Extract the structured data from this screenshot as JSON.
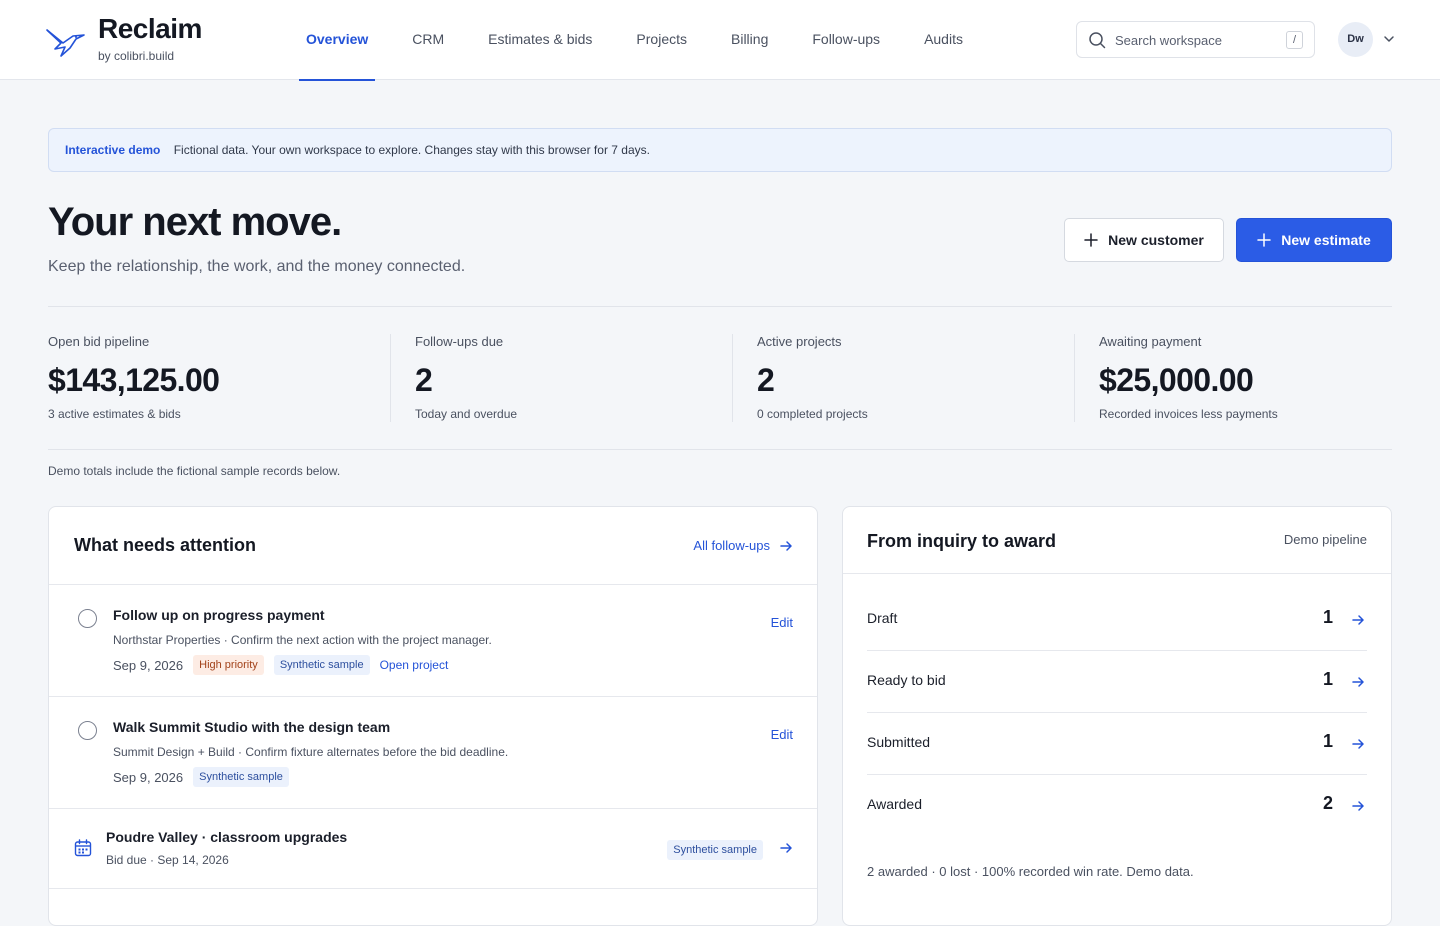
{
  "brand": {
    "name": "Reclaim",
    "sub": "by colibri.build",
    "accent": "#2453d8"
  },
  "nav": {
    "items": [
      "Overview",
      "CRM",
      "Estimates & bids",
      "Projects",
      "Billing",
      "Follow-ups",
      "Audits"
    ],
    "active": "Overview"
  },
  "search": {
    "placeholder": "Search workspace",
    "shortcut": "/"
  },
  "user": {
    "initials": "Dw"
  },
  "banner": {
    "tag": "Interactive demo",
    "text": "Fictional data. Your own workspace to explore. Changes stay with this browser for 7 days."
  },
  "hero": {
    "title": "Your next move.",
    "subtitle": "Keep the relationship, the work, and the money connected.",
    "new_customer_label": "New customer",
    "new_estimate_label": "New estimate"
  },
  "stats": [
    {
      "label": "Open bid pipeline",
      "value": "$143,125.00",
      "note": "3 active estimates & bids"
    },
    {
      "label": "Follow-ups due",
      "value": "2",
      "note": "Today and overdue"
    },
    {
      "label": "Active projects",
      "value": "2",
      "note": "0 completed projects"
    },
    {
      "label": "Awaiting payment",
      "value": "$25,000.00",
      "note": "Recorded invoices less payments"
    }
  ],
  "totals_note": "Demo totals include the fictional sample records below.",
  "attention": {
    "title": "What needs attention",
    "all_link": "All follow-ups",
    "tasks": [
      {
        "title": "Follow up on progress payment",
        "desc": "Northstar Properties · Confirm the next action with the project manager.",
        "date": "Sep 9, 2026",
        "priority": "High priority",
        "sample": "Synthetic sample",
        "link": "Open project",
        "edit": "Edit"
      },
      {
        "title": "Walk Summit Studio with the design team",
        "desc": "Summit Design + Build · Confirm fixture alternates before the bid deadline.",
        "date": "Sep 9, 2026",
        "sample": "Synthetic sample",
        "edit": "Edit"
      }
    ],
    "bid": {
      "title": "Poudre Valley · classroom upgrades",
      "sub": "Bid due · Sep 14, 2026",
      "sample": "Synthetic sample"
    }
  },
  "pipeline": {
    "title": "From inquiry to award",
    "tag": "Demo pipeline",
    "stages": [
      {
        "name": "Draft",
        "count": "1"
      },
      {
        "name": "Ready to bid",
        "count": "1"
      },
      {
        "name": "Submitted",
        "count": "1"
      },
      {
        "name": "Awarded",
        "count": "2"
      }
    ],
    "summary": "2 awarded · 0 lost · 100% recorded win rate. Demo data."
  }
}
